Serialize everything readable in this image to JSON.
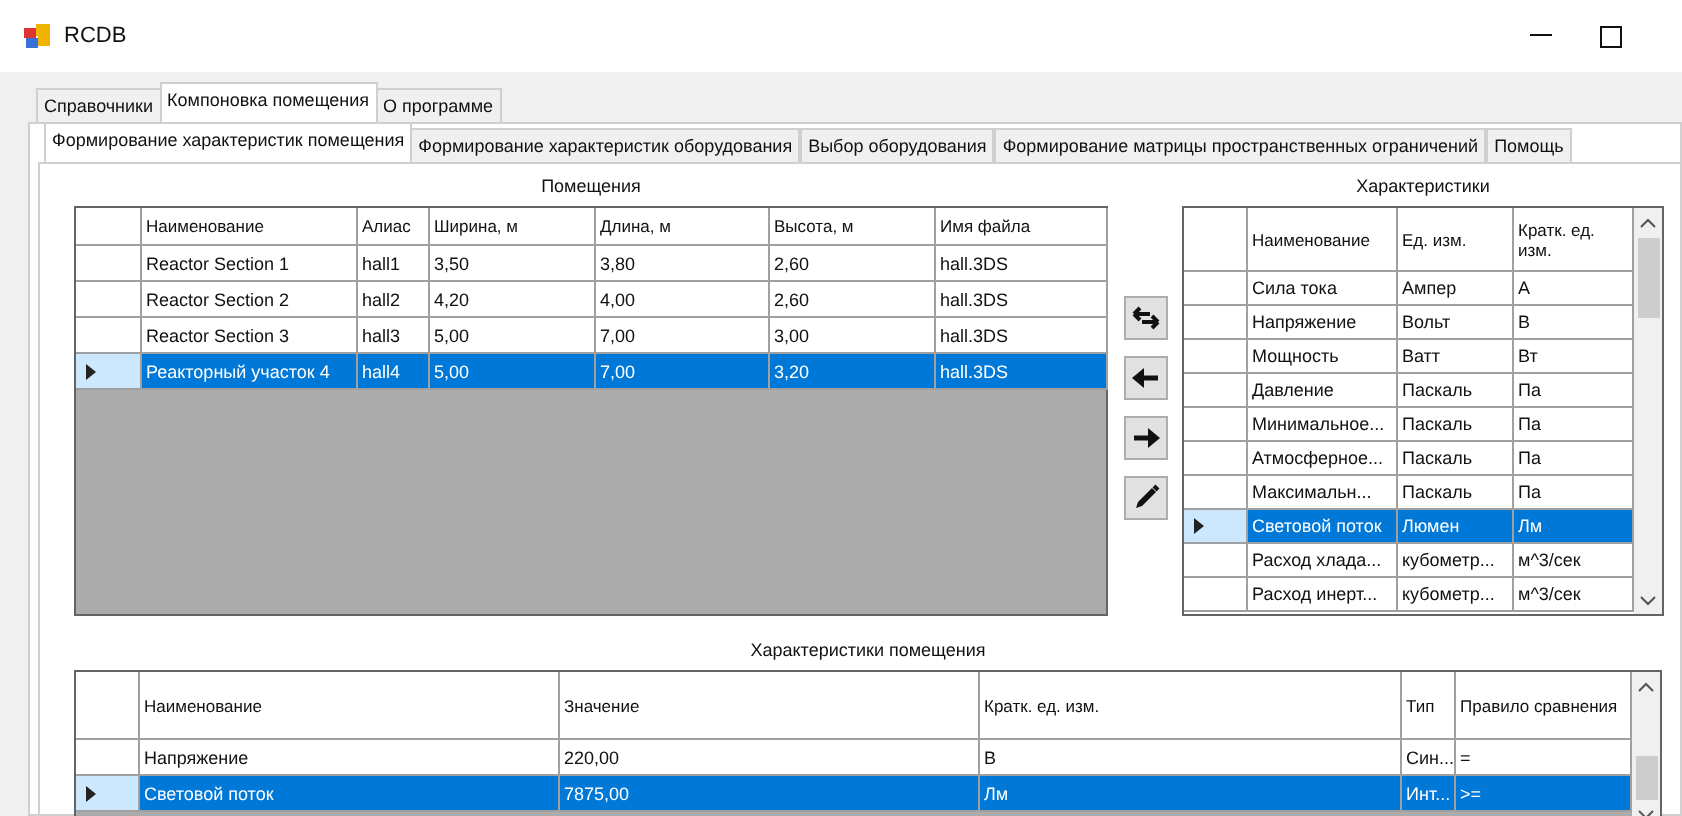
{
  "window": {
    "title": "RCDB"
  },
  "tabs": [
    {
      "label": "Справочники",
      "selected": false
    },
    {
      "label": "Компоновка помещения",
      "selected": true
    },
    {
      "label": "О программе",
      "selected": false
    }
  ],
  "subtabs": [
    {
      "label": "Формирование характеристик помещения",
      "selected": true
    },
    {
      "label": "Формирование характеристик оборудования",
      "selected": false
    },
    {
      "label": "Выбор оборудования",
      "selected": false
    },
    {
      "label": "Формирование матрицы пространственных ограничений",
      "selected": false
    },
    {
      "label": "Помощь",
      "selected": false
    }
  ],
  "rooms": {
    "title": "Помещения",
    "columns": [
      "Наименование",
      "Алиас",
      "Ширина, м",
      "Длина, м",
      "Высота, м",
      "Имя файла"
    ],
    "rows": [
      {
        "cells": [
          "Reactor Section 1",
          "hall1",
          "3,50",
          "3,80",
          "2,60",
          "hall.3DS"
        ],
        "selected": false
      },
      {
        "cells": [
          "Reactor Section 2",
          "hall2",
          "4,20",
          "4,00",
          "2,60",
          "hall.3DS"
        ],
        "selected": false
      },
      {
        "cells": [
          "Reactor Section 3",
          "hall3",
          "5,00",
          "7,00",
          "3,00",
          "hall.3DS"
        ],
        "selected": false
      },
      {
        "cells": [
          "Реакторный участок 4",
          "hall4",
          "5,00",
          "7,00",
          "3,20",
          "hall.3DS"
        ],
        "selected": true
      }
    ]
  },
  "characteristics": {
    "title": "Характеристики",
    "columns": [
      "Наименование",
      "Ед. изм.",
      "Кратк. ед. изм."
    ],
    "rows": [
      {
        "cells": [
          "Сила тока",
          "Ампер",
          "А"
        ],
        "selected": false
      },
      {
        "cells": [
          "Напряжение",
          "Вольт",
          "В"
        ],
        "selected": false
      },
      {
        "cells": [
          "Мощность",
          "Ватт",
          "Вт"
        ],
        "selected": false
      },
      {
        "cells": [
          "Давление",
          "Паскаль",
          "Па"
        ],
        "selected": false
      },
      {
        "cells": [
          "Минимальное...",
          "Паскаль",
          "Па"
        ],
        "selected": false
      },
      {
        "cells": [
          "Атмосферное...",
          "Паскаль",
          "Па"
        ],
        "selected": false
      },
      {
        "cells": [
          "Максимальн...",
          "Паскаль",
          "Па"
        ],
        "selected": false
      },
      {
        "cells": [
          "Световой поток",
          "Люмен",
          "Лм"
        ],
        "selected": true
      },
      {
        "cells": [
          "Расход хлада...",
          "кубометр...",
          "м^3/сек"
        ],
        "selected": false
      },
      {
        "cells": [
          "Расход инерт...",
          "кубометр...",
          "м^3/сек"
        ],
        "selected": false
      }
    ]
  },
  "room_characteristics": {
    "title": "Характеристики помещения",
    "columns": [
      "Наименование",
      "Значение",
      "Кратк. ед. изм.",
      "Тип",
      "Правило сравнения"
    ],
    "rows": [
      {
        "cells": [
          "Напряжение",
          "220,00",
          "В",
          "Син...",
          "="
        ],
        "selected": false
      },
      {
        "cells": [
          "Световой поток",
          "7875,00",
          "Лм",
          "Инт...",
          ">="
        ],
        "selected": true
      }
    ]
  }
}
